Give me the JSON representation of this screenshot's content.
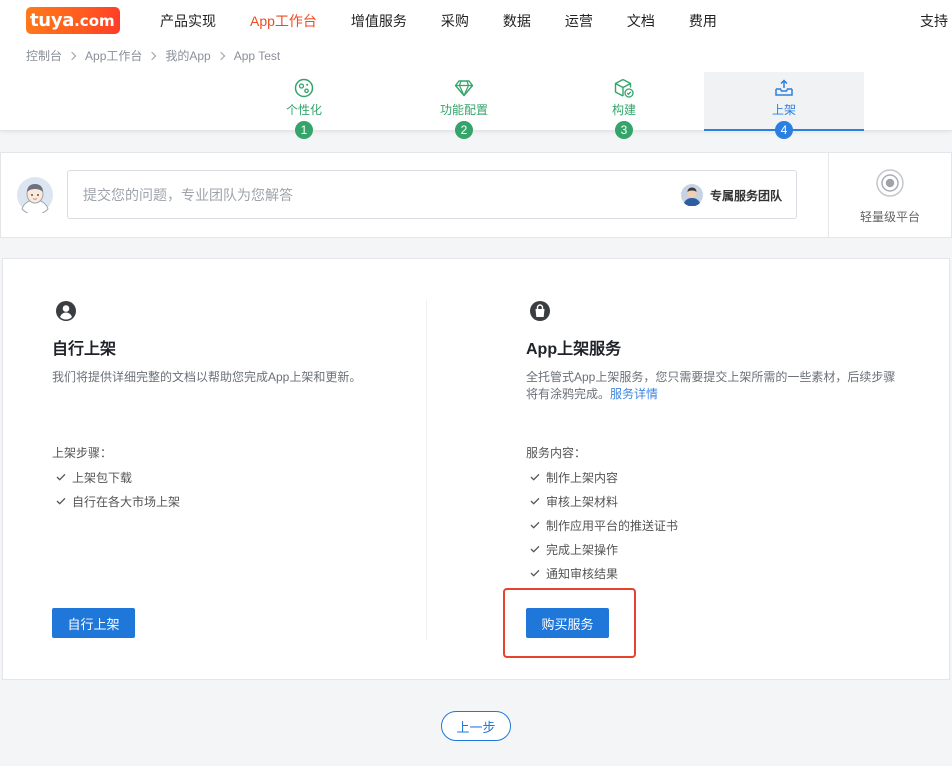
{
  "colors": {
    "brand": "#ff5a1f",
    "nav_active": "#f04a22",
    "step_done": "#35a46b",
    "step_active": "#2b7fe0",
    "primary": "#1f77d9",
    "link": "#3d86e0",
    "highlight": "#e5432d"
  },
  "logo": {
    "name": "tuya",
    "suffix": ".com"
  },
  "nav": {
    "items": [
      {
        "label": "产品实现",
        "active": false
      },
      {
        "label": "App工作台",
        "active": true
      },
      {
        "label": "增值服务",
        "active": false
      },
      {
        "label": "采购",
        "active": false
      },
      {
        "label": "数据",
        "active": false
      },
      {
        "label": "运营",
        "active": false
      },
      {
        "label": "文档",
        "active": false
      },
      {
        "label": "费用",
        "active": false
      }
    ],
    "support_label": "支持"
  },
  "breadcrumb": [
    "控制台",
    "App工作台",
    "我的App",
    "App Test"
  ],
  "steps": [
    {
      "label": "个性化",
      "number": "1",
      "icon": "palette-icon",
      "active": false
    },
    {
      "label": "功能配置",
      "number": "2",
      "icon": "diamond-icon",
      "active": false
    },
    {
      "label": "构建",
      "number": "3",
      "icon": "box-check-icon",
      "active": false
    },
    {
      "label": "上架",
      "number": "4",
      "icon": "upload-icon",
      "active": true
    }
  ],
  "question": {
    "avatar_icon": "user-avatar-icon",
    "placeholder": "提交您的问题，专业团队为您解答",
    "team_label": "专属服务团队",
    "platform_label": "轻量级平台",
    "platform_icon": "target-icon"
  },
  "options": {
    "self": {
      "icon": "user-circle-icon",
      "title": "自行上架",
      "description": "我们将提供详细完整的文档以帮助您完成App上架和更新。",
      "list_title": "上架步骤：",
      "items": [
        "上架包下载",
        "自行在各大市场上架"
      ],
      "button_label": "自行上架"
    },
    "service": {
      "icon": "shopping-bag-icon",
      "title": "App上架服务",
      "description": "全托管式App上架服务，您只需要提交上架所需的一些素材，后续步骤将有涂鸦完成。",
      "link_label": "服务详情",
      "list_title": "服务内容：",
      "items": [
        "制作上架内容",
        "审核上架材料",
        "制作应用平台的推送证书",
        "完成上架操作",
        "通知审核结果"
      ],
      "button_label": "购买服务",
      "highlighted": true
    }
  },
  "prev_button_label": "上一步"
}
